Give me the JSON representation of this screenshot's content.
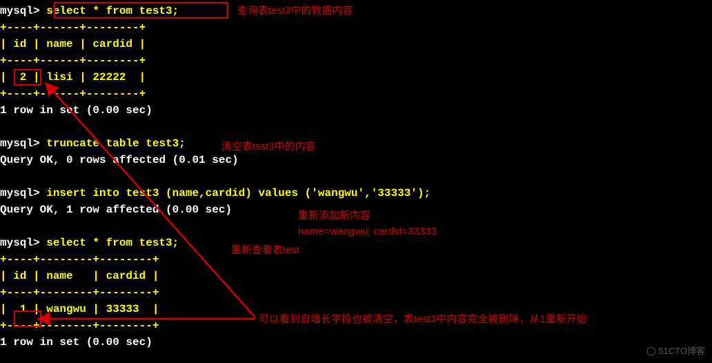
{
  "prompt": "mysql>",
  "query1": {
    "command": "select * from test3;",
    "border": "+----+------+--------+",
    "header": "| id | name | cardid |",
    "row": "|  2 | lisi | 22222  |",
    "result": "1 row in set (0.00 sec)"
  },
  "query2": {
    "command": "truncate table test3;",
    "result": "Query OK, 0 rows affected (0.01 sec)"
  },
  "query3": {
    "command": "insert into test3 (name,cardid) values ('wangwu','33333');",
    "result": "Query OK, 1 row affected (0.00 sec)"
  },
  "query4": {
    "command": "select * from test3;",
    "border": "+----+--------+--------+",
    "header": "| id | name   | cardid |",
    "row": "|  1 | wangwu | 33333  |",
    "result": "1 row in set (0.00 sec)"
  },
  "annotations": {
    "a1": "查询表test3中的数据内容",
    "a2": "清空表tsst3中的内容",
    "a3_line1": "重新添加新内容",
    "a3_line2": "name=wangwu; cardid=33333",
    "a4": "重新查看表test",
    "a5": "可以看到自增长字段也被清空，表test3中内容完全被删除，从1重新开始"
  },
  "watermark": "51CTO博客"
}
